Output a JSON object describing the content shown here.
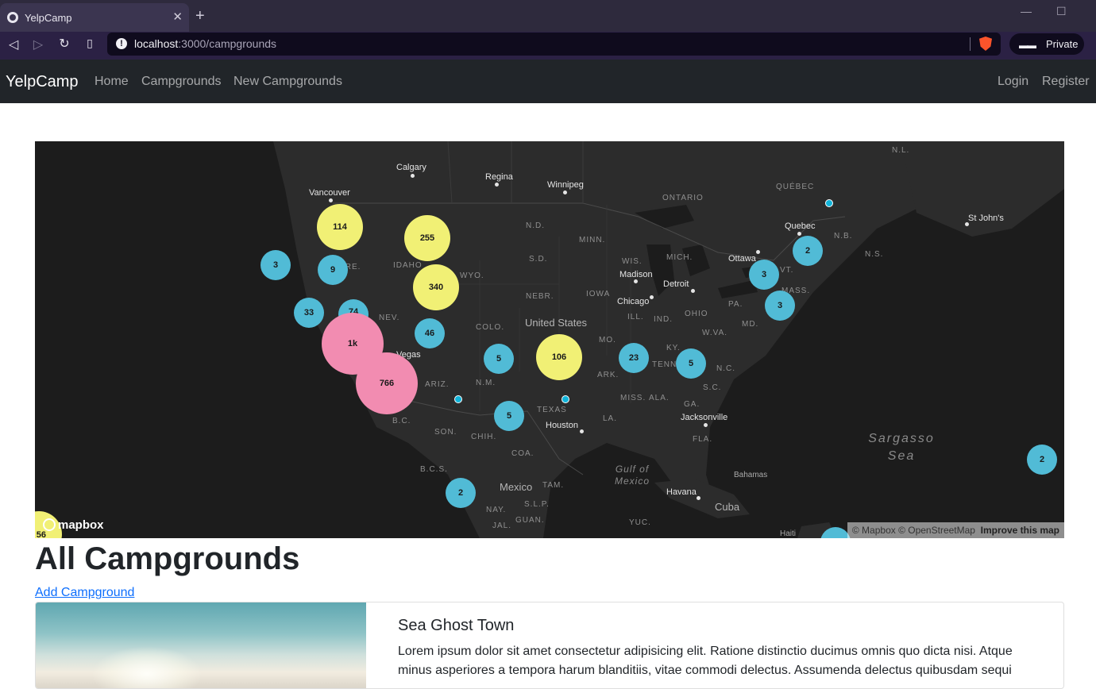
{
  "browser": {
    "tab_title": "YelpCamp",
    "tab_close": "✕",
    "new_tab": "+",
    "url_host": "localhost",
    "url_path": ":3000/campgrounds",
    "private_label": "Private"
  },
  "navbar": {
    "brand": "YelpCamp",
    "links": [
      "Home",
      "Campgrounds",
      "New Campgrounds"
    ],
    "right_links": [
      "Login",
      "Register"
    ]
  },
  "map": {
    "cities": [
      "Calgary",
      "Regina",
      "Winnipeg",
      "Vancouver",
      "Quebec",
      "St John's",
      "Ottawa",
      "Madison",
      "Detroit",
      "Chicago",
      "Houston",
      "Jacksonville",
      "Havana",
      "Bahamas",
      "Haiti",
      "Vegas"
    ],
    "states": [
      "N.L.",
      "QUÉBEC",
      "ONTARIO",
      "N.D.",
      "MINN.",
      "S.D.",
      "WIS.",
      "MICH.",
      "IDAHO",
      "WYO.",
      "NEBR.",
      "IOWA",
      "NEV.",
      "COLO.",
      "ILL.",
      "IND.",
      "OHIO",
      "PA.",
      "N.B.",
      "N.S.",
      "VT.",
      "MASS.",
      "MD.",
      "W.VA.",
      "MO.",
      "KY.",
      "TENN.",
      "N.C.",
      "S.C.",
      "ARK.",
      "MISS.",
      "ALA.",
      "GA.",
      "ARIZ.",
      "N.M.",
      "TEXAS",
      "LA.",
      "FLA.",
      "B.C.",
      "SON.",
      "CHIH.",
      "COA.",
      "B.C.S.",
      "TAM.",
      "S.L.P.",
      "NAY.",
      "GUAN.",
      "JAL.",
      "YUC.",
      "ORE."
    ],
    "countries": [
      "United States",
      "Mexico",
      "Cuba"
    ],
    "seas": [
      "Sargasso Sea",
      "Gulf of Mexico"
    ],
    "clusters": [
      "114",
      "255",
      "340",
      "3",
      "9",
      "33",
      "74",
      "1k",
      "766",
      "46",
      "5",
      "106",
      "23",
      "5",
      "5",
      "2",
      "3",
      "3",
      "2",
      "2",
      "56"
    ],
    "attribution": "© Mapbox © OpenStreetMap",
    "improve": "Improve this map",
    "logo": "mapbox",
    "colors": {
      "small": "#51bbd6",
      "medium": "#f1f075",
      "large": "#f28cb1"
    }
  },
  "page": {
    "heading": "All Campgrounds",
    "add_link": "Add Campground"
  },
  "campground": {
    "title": "Sea Ghost Town",
    "description": "Lorem ipsum dolor sit amet consectetur adipisicing elit. Ratione distinctio ducimus omnis quo dicta nisi. Atque minus asperiores a tempora harum blanditiis, vitae commodi delectus. Assumenda delectus quibusdam sequi"
  }
}
